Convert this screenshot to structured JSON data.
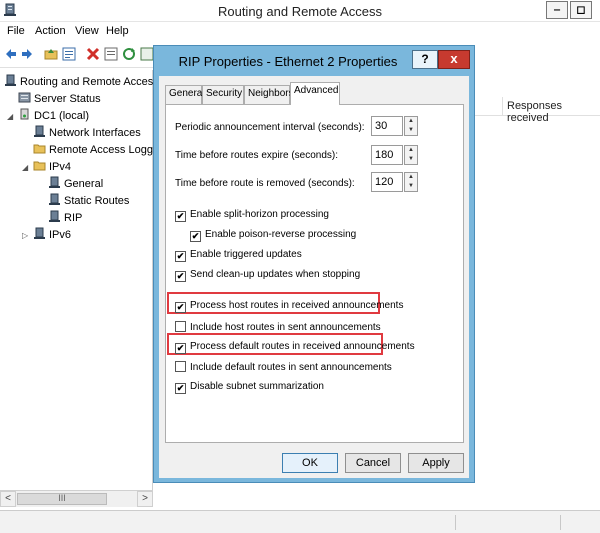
{
  "window": {
    "title": "Routing and Remote Access",
    "minimize_glyph": "‒",
    "maximize_glyph": "◻"
  },
  "menu": [
    "File",
    "Action",
    "View",
    "Help"
  ],
  "toolbar_icons": [
    "back-arrow-icon",
    "forward-arrow-icon",
    "folder-up-icon",
    "properties-icon",
    "delete-icon",
    "export-list-icon",
    "refresh-icon",
    "help-icon"
  ],
  "tree": {
    "root": "Routing and Remote Access",
    "server_status": "Server Status",
    "dc1": "DC1 (local)",
    "network_interfaces": "Network Interfaces",
    "remote_access_logging": "Remote Access Logging",
    "ipv4": "IPv4",
    "general": "General",
    "static_routes": "Static Routes",
    "rip": "RIP",
    "ipv6": "IPv6"
  },
  "list": {
    "column_responses": "Responses received"
  },
  "scrollbar": {
    "left": "<",
    "right": ">",
    "thumb": "III"
  },
  "dialog": {
    "title": "RIP Properties - Ethernet 2 Properties",
    "help_glyph": "?",
    "close_glyph": "x",
    "tabs": [
      "General",
      "Security",
      "Neighbors",
      "Advanced"
    ],
    "active_tab": "Advanced",
    "fields": {
      "announcement_label": "Periodic announcement interval (seconds):",
      "announcement_value": "30",
      "expire_label": "Time before routes expire (seconds):",
      "expire_value": "180",
      "removed_label": "Time before route is removed (seconds):",
      "removed_value": "120"
    },
    "checkboxes": {
      "split_horizon": "Enable split-horizon processing",
      "poison_reverse": "Enable poison-reverse processing",
      "triggered_updates": "Enable triggered updates",
      "clean_up": "Send clean-up updates when stopping",
      "process_host_routes": "Process host routes in received announcements",
      "include_host_routes": "Include host routes in sent announcements",
      "process_default_routes": "Process default routes in received announcements",
      "include_default_routes": "Include default routes in sent announcements",
      "disable_subnet": "Disable subnet summarization"
    },
    "checked": {
      "split_horizon": true,
      "poison_reverse": true,
      "triggered_updates": true,
      "clean_up": true,
      "process_host_routes": true,
      "include_host_routes": false,
      "process_default_routes": true,
      "include_default_routes": false,
      "disable_subnet": true
    },
    "buttons": {
      "ok": "OK",
      "cancel": "Cancel",
      "apply": "Apply"
    },
    "check_glyph": "✔",
    "highlight_color": "#e03a40"
  }
}
